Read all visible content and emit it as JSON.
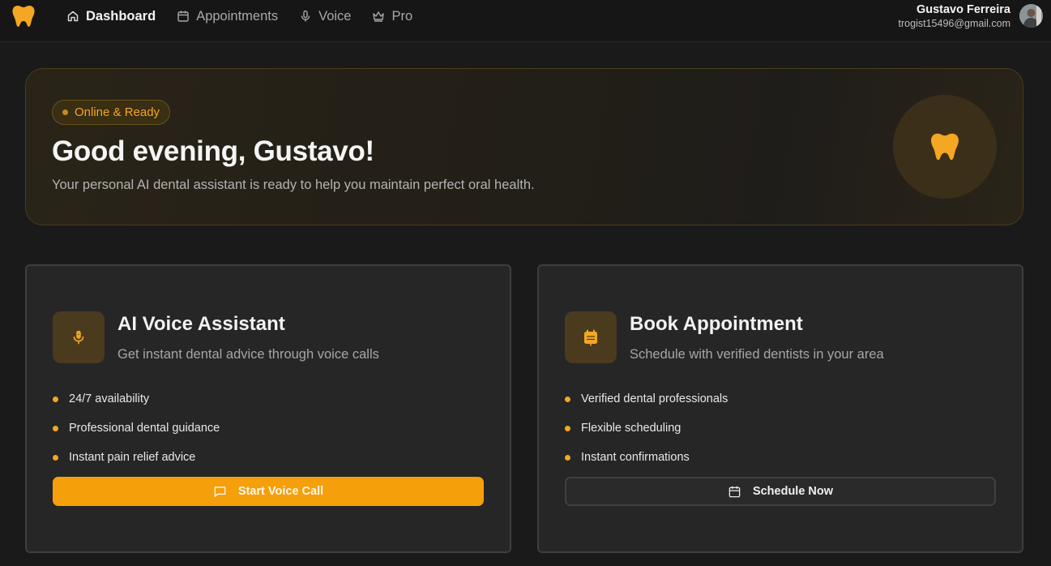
{
  "nav": {
    "links": [
      {
        "label": "Dashboard",
        "icon": "home-icon",
        "active": true
      },
      {
        "label": "Appointments",
        "icon": "calendar-icon",
        "active": false
      },
      {
        "label": "Voice",
        "icon": "microphone-icon",
        "active": false
      },
      {
        "label": "Pro",
        "icon": "crown-icon",
        "active": false
      }
    ],
    "user": {
      "name": "Gustavo Ferreira",
      "email": "trogist15496@gmail.com"
    }
  },
  "hero": {
    "status": "Online & Ready",
    "title": "Good evening, Gustavo!",
    "subtitle": "Your personal AI dental assistant is ready to help you maintain perfect oral health."
  },
  "cards": [
    {
      "title": "AI Voice Assistant",
      "subtitle": "Get instant dental advice through voice calls",
      "icon": "microphone-icon",
      "features": [
        "24/7 availability",
        "Professional dental guidance",
        "Instant pain relief advice"
      ],
      "button": {
        "label": "Start Voice Call",
        "icon": "chat-icon"
      }
    },
    {
      "title": "Book Appointment",
      "subtitle": "Schedule with verified dentists in your area",
      "icon": "calendar-icon",
      "features": [
        "Verified dental professionals",
        "Flexible scheduling",
        "Instant confirmations"
      ],
      "button": {
        "label": "Schedule Now",
        "icon": "calendar-icon"
      }
    }
  ],
  "colors": {
    "accent": "#f59f0b",
    "background": "#1a1a1a",
    "card": "#262626"
  }
}
